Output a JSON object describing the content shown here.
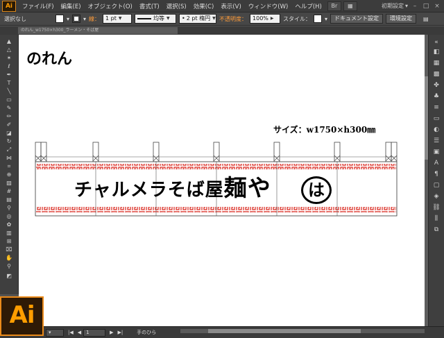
{
  "menubar": {
    "logo": "Ai",
    "items": [
      "ファイル(F)",
      "編集(E)",
      "オブジェクト(O)",
      "書式(T)",
      "選択(S)",
      "効果(C)",
      "表示(V)",
      "ウィンドウ(W)",
      "ヘルプ(H)"
    ],
    "workspace": "初期設定"
  },
  "controlbar": {
    "selection_status": "選択なし",
    "stroke_label": "線：",
    "stroke_weight": "1 pt",
    "stroke_profile": "均等",
    "brush": "2 pt 楕円",
    "opacity_label": "不透明度：",
    "opacity_value": "100%",
    "style_label": "スタイル：",
    "document_settings": "ドキュメント設定",
    "preferences": "環境設定"
  },
  "doctab": {
    "title": "のれん_w1750×h300_ラーメン・そば屋"
  },
  "artwork": {
    "title": "のれん",
    "size": "サイズ：w1750×h300㎜",
    "main_text": "チャルメラそば屋",
    "main_text_big": "麺や",
    "circle_text": "は",
    "accent_color": "#d9241b"
  },
  "statusbar": {
    "zoom": "",
    "page": "1",
    "tool": "手のひら"
  }
}
